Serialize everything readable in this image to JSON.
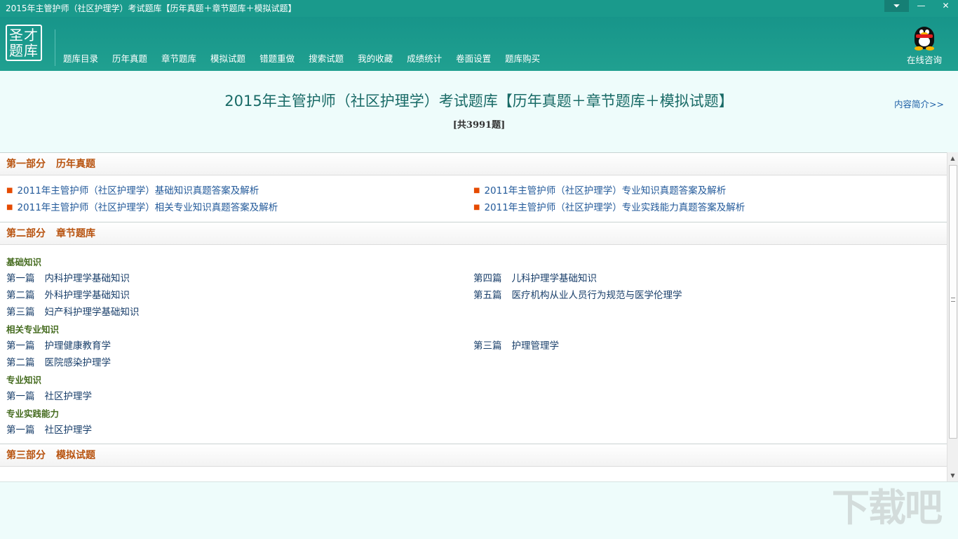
{
  "window": {
    "title": "2015年主管护师（社区护理学）考试题库【历年真题＋章节题库＋模拟试题】"
  },
  "header": {
    "logo_text": "圣才题库",
    "nav": [
      "题库目录",
      "历年真题",
      "章节题库",
      "模拟试题",
      "错题重做",
      "搜索试题",
      "我的收藏",
      "成绩统计",
      "卷面设置",
      "题库购买"
    ],
    "consult_label": "在线咨询"
  },
  "main": {
    "title": "2015年主管护师（社区护理学）考试题库【历年真题＋章节题库＋模拟试题】",
    "count": "[共3991题]",
    "intro_link": "内容简介>>"
  },
  "sections": {
    "part1": {
      "num": "第一部分",
      "name": "历年真题",
      "links": [
        "2011年主管护师（社区护理学）基础知识真题答案及解析",
        "2011年主管护师（社区护理学）专业知识真题答案及解析",
        "2011年主管护师（社区护理学）相关专业知识真题答案及解析",
        "2011年主管护师（社区护理学）专业实践能力真题答案及解析"
      ]
    },
    "part2": {
      "num": "第二部分",
      "name": "章节题库",
      "groups": [
        {
          "title": "基础知识",
          "items": [
            {
              "num": "第一篇",
              "name": "内科护理学基础知识"
            },
            {
              "num": "第四篇",
              "name": "儿科护理学基础知识"
            },
            {
              "num": "第二篇",
              "name": "外科护理学基础知识"
            },
            {
              "num": "第五篇",
              "name": "医疗机构从业人员行为规范与医学伦理学"
            },
            {
              "num": "第三篇",
              "name": "妇产科护理学基础知识"
            }
          ]
        },
        {
          "title": "相关专业知识",
          "items": [
            {
              "num": "第一篇",
              "name": "护理健康教育学"
            },
            {
              "num": "第三篇",
              "name": "护理管理学"
            },
            {
              "num": "第二篇",
              "name": "医院感染护理学"
            }
          ]
        },
        {
          "title": "专业知识",
          "items": [
            {
              "num": "第一篇",
              "name": "社区护理学"
            }
          ]
        },
        {
          "title": "专业实践能力",
          "items": [
            {
              "num": "第一篇",
              "name": "社区护理学"
            }
          ]
        }
      ]
    },
    "part3": {
      "num": "第三部分",
      "name": "模拟试题"
    }
  },
  "watermark": "下载吧",
  "colors": {
    "header_bg": "#1a9a8c",
    "page_bg": "#eefcfb",
    "section_title": "#b8530f",
    "subhead": "#456b1f",
    "link": "#235a9a",
    "main_title": "#186a66"
  }
}
